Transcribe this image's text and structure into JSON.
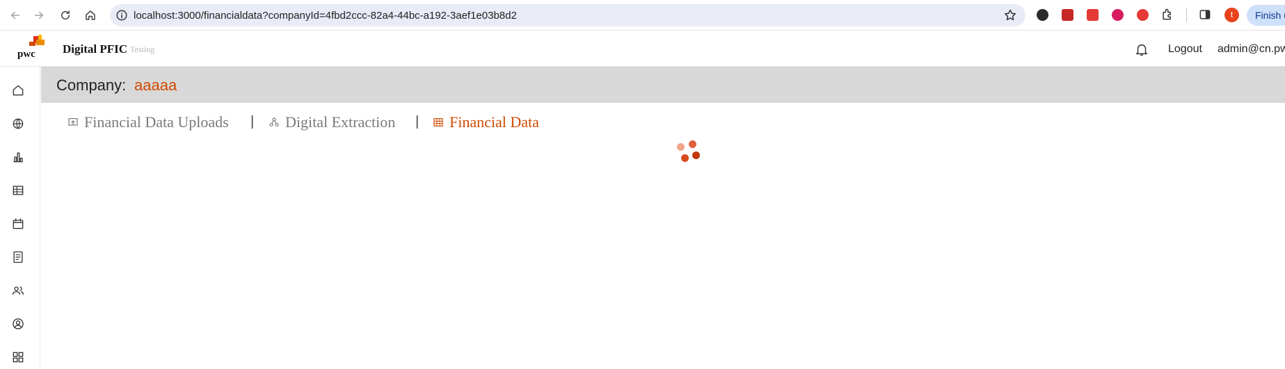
{
  "browser": {
    "url": "localhost:3000/financialdata?companyId=4fbd2ccc-82a4-44bc-a192-3aef1e03b8d2",
    "profile_initial": "t",
    "finish_button_label": "Finish u"
  },
  "header": {
    "brand": "pwc",
    "app_title": "Digital PFIC",
    "app_env": "Testing",
    "logout_label": "Logout",
    "user_email": "admin@cn.pw"
  },
  "company": {
    "label": "Company:",
    "name": "aaaaa"
  },
  "tabs": [
    {
      "label": "Financial Data Uploads",
      "icon": "upload-icon",
      "active": false
    },
    {
      "label": "Digital Extraction",
      "icon": "extraction-icon",
      "active": false
    },
    {
      "label": "Financial Data",
      "icon": "table-icon",
      "active": true
    }
  ],
  "tab_separator": "|",
  "sidebar": {
    "items": [
      {
        "icon": "home-icon"
      },
      {
        "icon": "globe-icon"
      },
      {
        "icon": "bar-chart-icon"
      },
      {
        "icon": "table-icon"
      },
      {
        "icon": "calendar-icon"
      },
      {
        "icon": "document-icon"
      },
      {
        "icon": "users-icon"
      },
      {
        "icon": "user-circle-icon"
      },
      {
        "icon": "apps-grid-icon"
      }
    ]
  },
  "colors": {
    "accent": "#d04a02",
    "company_band": "#d8d8d8",
    "spinner": [
      "#f1a58a",
      "#e0603a",
      "#d84a1e",
      "#c4370c"
    ]
  }
}
